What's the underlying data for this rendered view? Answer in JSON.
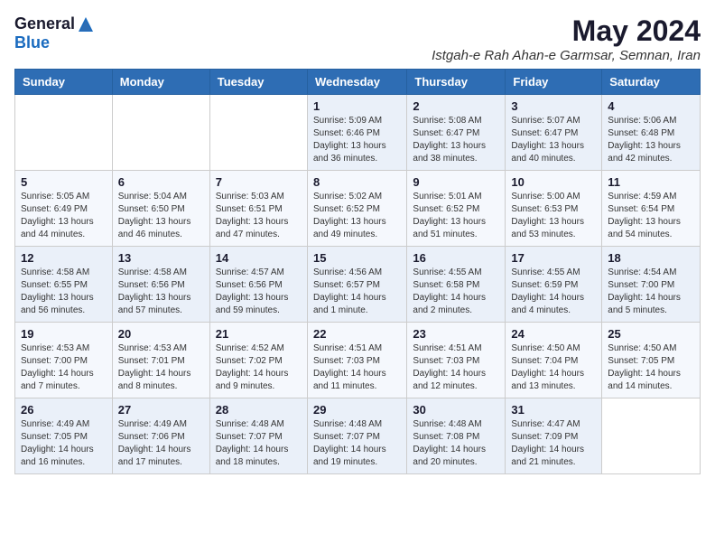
{
  "header": {
    "logo_general": "General",
    "logo_blue": "Blue",
    "month_title": "May 2024",
    "location": "Istgah-e Rah Ahan-e Garmsar, Semnan, Iran"
  },
  "weekdays": [
    "Sunday",
    "Monday",
    "Tuesday",
    "Wednesday",
    "Thursday",
    "Friday",
    "Saturday"
  ],
  "weeks": [
    [
      {
        "day": "",
        "info": ""
      },
      {
        "day": "",
        "info": ""
      },
      {
        "day": "",
        "info": ""
      },
      {
        "day": "1",
        "info": "Sunrise: 5:09 AM\nSunset: 6:46 PM\nDaylight: 13 hours and 36 minutes."
      },
      {
        "day": "2",
        "info": "Sunrise: 5:08 AM\nSunset: 6:47 PM\nDaylight: 13 hours and 38 minutes."
      },
      {
        "day": "3",
        "info": "Sunrise: 5:07 AM\nSunset: 6:47 PM\nDaylight: 13 hours and 40 minutes."
      },
      {
        "day": "4",
        "info": "Sunrise: 5:06 AM\nSunset: 6:48 PM\nDaylight: 13 hours and 42 minutes."
      }
    ],
    [
      {
        "day": "5",
        "info": "Sunrise: 5:05 AM\nSunset: 6:49 PM\nDaylight: 13 hours and 44 minutes."
      },
      {
        "day": "6",
        "info": "Sunrise: 5:04 AM\nSunset: 6:50 PM\nDaylight: 13 hours and 46 minutes."
      },
      {
        "day": "7",
        "info": "Sunrise: 5:03 AM\nSunset: 6:51 PM\nDaylight: 13 hours and 47 minutes."
      },
      {
        "day": "8",
        "info": "Sunrise: 5:02 AM\nSunset: 6:52 PM\nDaylight: 13 hours and 49 minutes."
      },
      {
        "day": "9",
        "info": "Sunrise: 5:01 AM\nSunset: 6:52 PM\nDaylight: 13 hours and 51 minutes."
      },
      {
        "day": "10",
        "info": "Sunrise: 5:00 AM\nSunset: 6:53 PM\nDaylight: 13 hours and 53 minutes."
      },
      {
        "day": "11",
        "info": "Sunrise: 4:59 AM\nSunset: 6:54 PM\nDaylight: 13 hours and 54 minutes."
      }
    ],
    [
      {
        "day": "12",
        "info": "Sunrise: 4:58 AM\nSunset: 6:55 PM\nDaylight: 13 hours and 56 minutes."
      },
      {
        "day": "13",
        "info": "Sunrise: 4:58 AM\nSunset: 6:56 PM\nDaylight: 13 hours and 57 minutes."
      },
      {
        "day": "14",
        "info": "Sunrise: 4:57 AM\nSunset: 6:56 PM\nDaylight: 13 hours and 59 minutes."
      },
      {
        "day": "15",
        "info": "Sunrise: 4:56 AM\nSunset: 6:57 PM\nDaylight: 14 hours and 1 minute."
      },
      {
        "day": "16",
        "info": "Sunrise: 4:55 AM\nSunset: 6:58 PM\nDaylight: 14 hours and 2 minutes."
      },
      {
        "day": "17",
        "info": "Sunrise: 4:55 AM\nSunset: 6:59 PM\nDaylight: 14 hours and 4 minutes."
      },
      {
        "day": "18",
        "info": "Sunrise: 4:54 AM\nSunset: 7:00 PM\nDaylight: 14 hours and 5 minutes."
      }
    ],
    [
      {
        "day": "19",
        "info": "Sunrise: 4:53 AM\nSunset: 7:00 PM\nDaylight: 14 hours and 7 minutes."
      },
      {
        "day": "20",
        "info": "Sunrise: 4:53 AM\nSunset: 7:01 PM\nDaylight: 14 hours and 8 minutes."
      },
      {
        "day": "21",
        "info": "Sunrise: 4:52 AM\nSunset: 7:02 PM\nDaylight: 14 hours and 9 minutes."
      },
      {
        "day": "22",
        "info": "Sunrise: 4:51 AM\nSunset: 7:03 PM\nDaylight: 14 hours and 11 minutes."
      },
      {
        "day": "23",
        "info": "Sunrise: 4:51 AM\nSunset: 7:03 PM\nDaylight: 14 hours and 12 minutes."
      },
      {
        "day": "24",
        "info": "Sunrise: 4:50 AM\nSunset: 7:04 PM\nDaylight: 14 hours and 13 minutes."
      },
      {
        "day": "25",
        "info": "Sunrise: 4:50 AM\nSunset: 7:05 PM\nDaylight: 14 hours and 14 minutes."
      }
    ],
    [
      {
        "day": "26",
        "info": "Sunrise: 4:49 AM\nSunset: 7:05 PM\nDaylight: 14 hours and 16 minutes."
      },
      {
        "day": "27",
        "info": "Sunrise: 4:49 AM\nSunset: 7:06 PM\nDaylight: 14 hours and 17 minutes."
      },
      {
        "day": "28",
        "info": "Sunrise: 4:48 AM\nSunset: 7:07 PM\nDaylight: 14 hours and 18 minutes."
      },
      {
        "day": "29",
        "info": "Sunrise: 4:48 AM\nSunset: 7:07 PM\nDaylight: 14 hours and 19 minutes."
      },
      {
        "day": "30",
        "info": "Sunrise: 4:48 AM\nSunset: 7:08 PM\nDaylight: 14 hours and 20 minutes."
      },
      {
        "day": "31",
        "info": "Sunrise: 4:47 AM\nSunset: 7:09 PM\nDaylight: 14 hours and 21 minutes."
      },
      {
        "day": "",
        "info": ""
      }
    ]
  ]
}
